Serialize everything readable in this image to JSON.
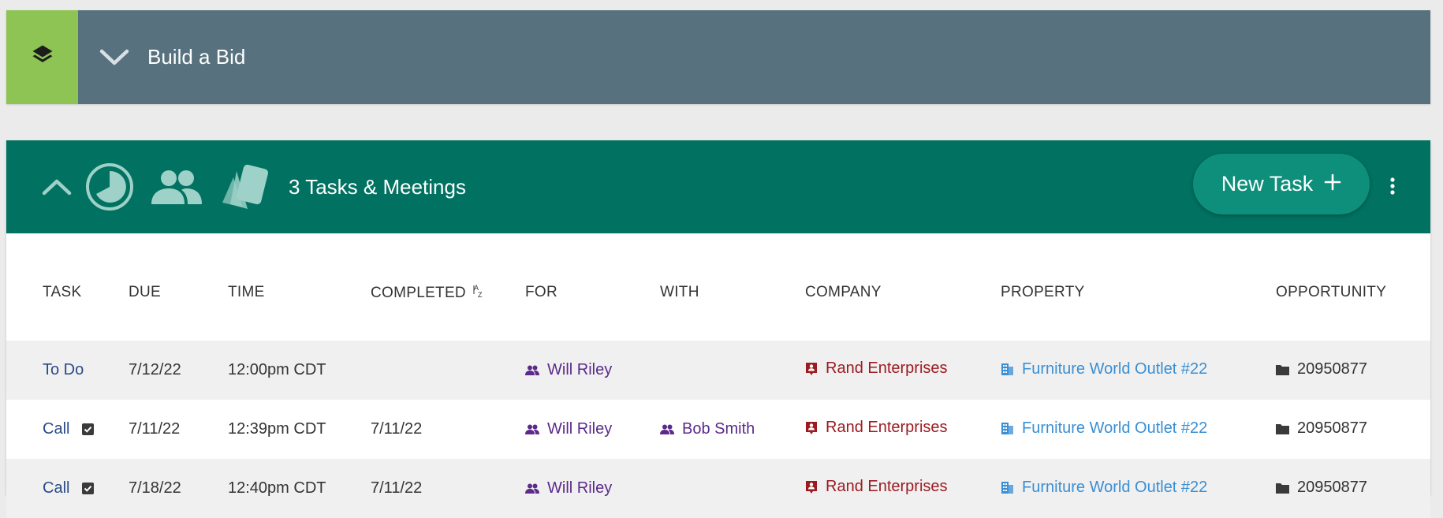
{
  "build_bid": {
    "title": "Build a Bid"
  },
  "tasks": {
    "title": "3 Tasks & Meetings",
    "new_task_label": "New Task",
    "columns": [
      "TASK",
      "DUE",
      "TIME",
      "COMPLETED",
      "FOR",
      "WITH",
      "COMPANY",
      "PROPERTY",
      "OPPORTUNITY"
    ],
    "sort_indicator": "AZ",
    "rows": [
      {
        "task": "To Do",
        "checked": false,
        "due": "7/12/22",
        "time": "12:00pm CDT",
        "completed": "",
        "for": "Will Riley",
        "with": "",
        "company": "Rand Enterprises",
        "property": "Furniture World Outlet #22",
        "opportunity": "20950877"
      },
      {
        "task": "Call",
        "checked": true,
        "due": "7/11/22",
        "time": "12:39pm CDT",
        "completed": "7/11/22",
        "for": "Will Riley",
        "with": "Bob Smith",
        "company": "Rand Enterprises",
        "property": "Furniture World Outlet #22",
        "opportunity": "20950877"
      },
      {
        "task": "Call",
        "checked": true,
        "due": "7/18/22",
        "time": "12:40pm CDT",
        "completed": "7/11/22",
        "for": "Will Riley",
        "with": "",
        "company": "Rand Enterprises",
        "property": "Furniture World Outlet #22",
        "opportunity": "20950877"
      }
    ]
  },
  "icons": {
    "layers": "layers-icon",
    "chevron_down": "chevron-down-icon",
    "chevron_up": "chevron-up-icon",
    "pie": "pie-chart-icon",
    "people": "people-icon",
    "cards": "cards-icon",
    "plus": "plus-icon",
    "more": "more-vertical-icon",
    "company": "company-badge-icon",
    "property": "building-icon",
    "folder": "folder-icon",
    "check": "checkbox-checked-icon"
  },
  "colors": {
    "bid_bar": "#57717e",
    "bid_accent": "#8dc454",
    "panel_header": "#017261",
    "new_task_button": "#0e8f7c",
    "task_link": "#2a4a86",
    "person": "#5b2a8a",
    "company": "#9b1b21",
    "property": "#3a8fd4"
  }
}
